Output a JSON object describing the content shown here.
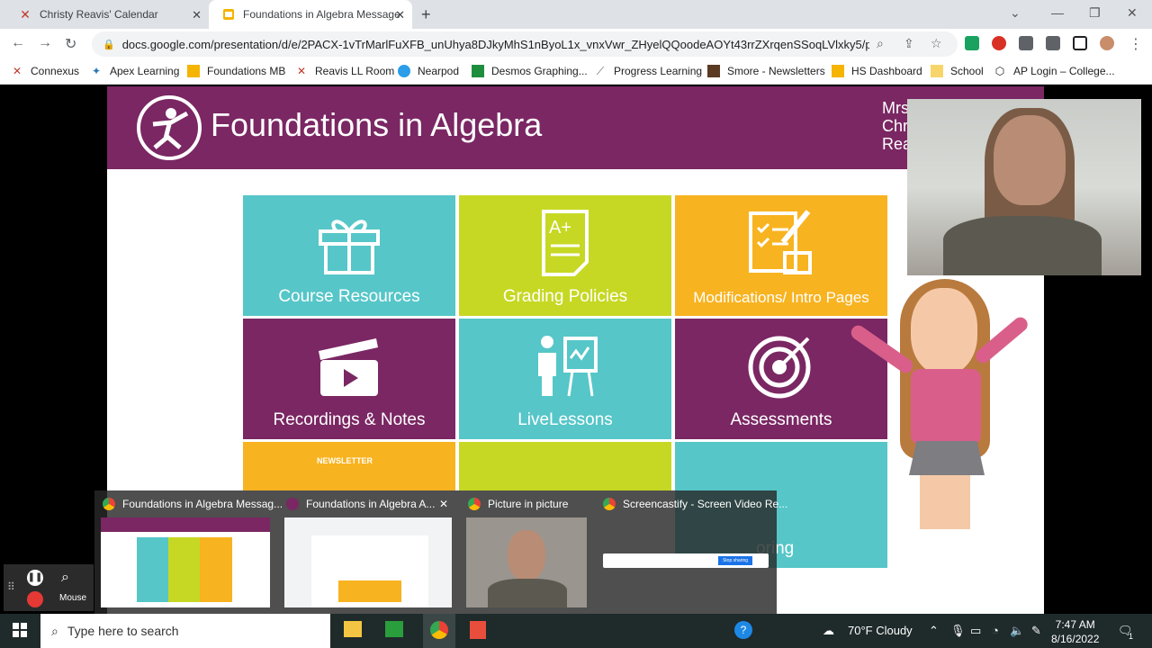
{
  "browser": {
    "tabs": [
      {
        "title": "Christy Reavis' Calendar",
        "icon": "connexus-icon"
      },
      {
        "title": "Foundations in Algebra Message",
        "icon": "slides-icon"
      }
    ],
    "url": "docs.google.com/presentation/d/e/2PACX-1vTrMarlFuXFB_unUhya8DJkyMhS1nByoL1x_vnxVwr_ZHyelQQoodeAOYt43rrZXrqenSSoqLVlxky5/p...",
    "bookmarks": [
      "Connexus",
      "Apex Learning",
      "Foundations MB",
      "Reavis LL Room",
      "Nearpod",
      "Desmos Graphing...",
      "Progress Learning",
      "Smore - Newsletters",
      "HS Dashboard",
      "School",
      "AP Login – College..."
    ]
  },
  "slide": {
    "title": "Foundations in Algebra",
    "teacher_lines": [
      "Mrs",
      "Chr",
      "Rea"
    ],
    "tiles": [
      {
        "label": "Course Resources"
      },
      {
        "label": "Grading Policies"
      },
      {
        "label": "Modifications/ Intro Pages"
      },
      {
        "label": "Recordings & Notes"
      },
      {
        "label": "LiveLessons"
      },
      {
        "label": "Assessments"
      },
      {
        "label": "oring"
      }
    ],
    "newsletter_text": "NEWSLETTER"
  },
  "taskbar_previews": [
    {
      "title": "Foundations in Algebra Messag..."
    },
    {
      "title": "Foundations in Algebra A..."
    },
    {
      "title": "Picture in picture"
    },
    {
      "title": "Screencastify - Screen Video Re..."
    }
  ],
  "screencastify": {
    "mouse_label": "Mouse",
    "stop_sharing": "Stop sharing"
  },
  "taskbar": {
    "search_placeholder": "Type here to search",
    "weather": "70°F  Cloudy",
    "time": "7:47 AM",
    "date": "8/16/2022",
    "notif_count": "1"
  }
}
